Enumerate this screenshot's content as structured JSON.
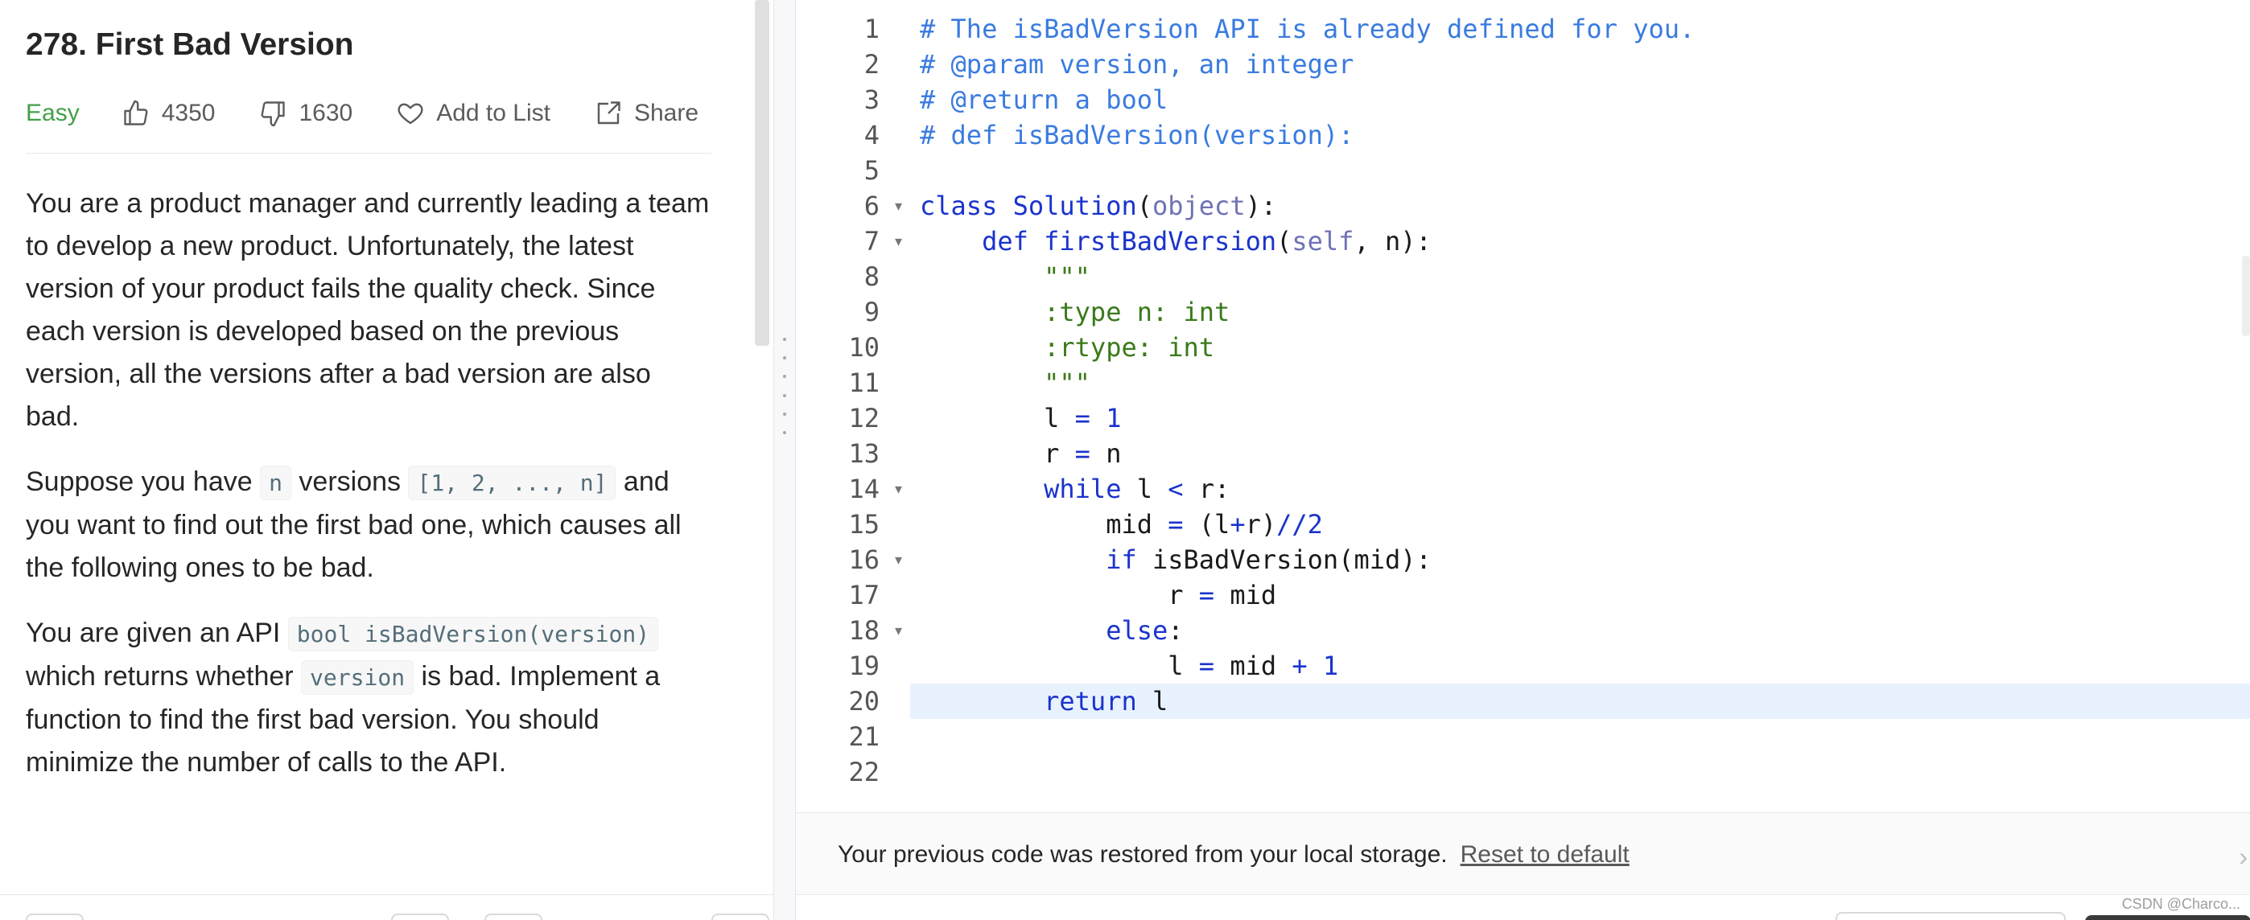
{
  "problem": {
    "title": "278. First Bad Version",
    "difficulty": "Easy",
    "likes": "4350",
    "dislikes": "1630",
    "add_to_list": "Add to List",
    "share": "Share",
    "colors": {
      "difficulty": "#43a047",
      "link_blue": "#1a33cc"
    },
    "icons": [
      "thumbs-up-icon",
      "thumbs-down-icon",
      "heart-icon",
      "share-icon"
    ]
  },
  "description": {
    "p1": "You are a product manager and currently leading a team to develop a new product. Unfortunately, the latest version of your product fails the quality check. Since each version is developed based on the previous version, all the versions after a bad version are also bad.",
    "p2_a": "Suppose you have ",
    "p2_code1": "n",
    "p2_b": " versions ",
    "p2_code2": "[1, 2, ..., n]",
    "p2_c": " and you want to find out the first bad one, which causes all the following ones to be bad.",
    "p3_a": "You are given an API ",
    "p3_code1": "bool isBadVersion(version)",
    "p3_b": " which returns whether ",
    "p3_code2": "version",
    "p3_c": " is bad. Implement a function to find the first bad version. You should minimize the number of calls to the API."
  },
  "editor": {
    "active_line": 20,
    "lines": [
      {
        "n": "1",
        "fold": false,
        "tokens": [
          [
            "comment",
            "# The isBadVersion API is already defined for you."
          ]
        ]
      },
      {
        "n": "2",
        "fold": false,
        "tokens": [
          [
            "comment",
            "# @param version, an integer"
          ]
        ]
      },
      {
        "n": "3",
        "fold": false,
        "tokens": [
          [
            "comment",
            "# @return a bool"
          ]
        ]
      },
      {
        "n": "4",
        "fold": false,
        "tokens": [
          [
            "comment",
            "# def isBadVersion(version):"
          ]
        ]
      },
      {
        "n": "5",
        "fold": false,
        "tokens": []
      },
      {
        "n": "6",
        "fold": true,
        "tokens": [
          [
            "keyword",
            "class"
          ],
          [
            "plain",
            " "
          ],
          [
            "def",
            "Solution"
          ],
          [
            "plain",
            "("
          ],
          [
            "builtin",
            "object"
          ],
          [
            "plain",
            "):"
          ]
        ]
      },
      {
        "n": "7",
        "fold": true,
        "tokens": [
          [
            "plain",
            "    "
          ],
          [
            "keyword",
            "def"
          ],
          [
            "plain",
            " "
          ],
          [
            "def",
            "firstBadVersion"
          ],
          [
            "plain",
            "("
          ],
          [
            "builtin",
            "self"
          ],
          [
            "plain",
            ", n):"
          ]
        ]
      },
      {
        "n": "8",
        "fold": false,
        "tokens": [
          [
            "plain",
            "        "
          ],
          [
            "string",
            "\"\"\""
          ]
        ]
      },
      {
        "n": "9",
        "fold": false,
        "tokens": [
          [
            "plain",
            "        "
          ],
          [
            "string",
            ":type n: int"
          ]
        ]
      },
      {
        "n": "10",
        "fold": false,
        "tokens": [
          [
            "plain",
            "        "
          ],
          [
            "string",
            ":rtype: int"
          ]
        ]
      },
      {
        "n": "11",
        "fold": false,
        "tokens": [
          [
            "plain",
            "        "
          ],
          [
            "string",
            "\"\"\""
          ]
        ]
      },
      {
        "n": "12",
        "fold": false,
        "tokens": [
          [
            "plain",
            "        l "
          ],
          [
            "operator",
            "="
          ],
          [
            "plain",
            " "
          ],
          [
            "number",
            "1"
          ]
        ]
      },
      {
        "n": "13",
        "fold": false,
        "tokens": [
          [
            "plain",
            "        r "
          ],
          [
            "operator",
            "="
          ],
          [
            "plain",
            " n"
          ]
        ]
      },
      {
        "n": "14",
        "fold": true,
        "tokens": [
          [
            "plain",
            "        "
          ],
          [
            "keyword",
            "while"
          ],
          [
            "plain",
            " l "
          ],
          [
            "operator",
            "<"
          ],
          [
            "plain",
            " r:"
          ]
        ]
      },
      {
        "n": "15",
        "fold": false,
        "tokens": [
          [
            "plain",
            "            mid "
          ],
          [
            "operator",
            "="
          ],
          [
            "plain",
            " (l"
          ],
          [
            "operator",
            "+"
          ],
          [
            "plain",
            "r)"
          ],
          [
            "operator",
            "//"
          ],
          [
            "number",
            "2"
          ]
        ]
      },
      {
        "n": "16",
        "fold": true,
        "tokens": [
          [
            "plain",
            "            "
          ],
          [
            "keyword",
            "if"
          ],
          [
            "plain",
            " isBadVersion(mid):"
          ]
        ]
      },
      {
        "n": "17",
        "fold": false,
        "tokens": [
          [
            "plain",
            "                r "
          ],
          [
            "operator",
            "="
          ],
          [
            "plain",
            " mid"
          ]
        ]
      },
      {
        "n": "18",
        "fold": true,
        "tokens": [
          [
            "plain",
            "            "
          ],
          [
            "keyword",
            "else"
          ],
          [
            "plain",
            ":"
          ]
        ]
      },
      {
        "n": "19",
        "fold": false,
        "tokens": [
          [
            "plain",
            "                l "
          ],
          [
            "operator",
            "="
          ],
          [
            "plain",
            " mid "
          ],
          [
            "operator",
            "+"
          ],
          [
            "plain",
            " "
          ],
          [
            "number",
            "1"
          ]
        ]
      },
      {
        "n": "20",
        "fold": false,
        "tokens": [
          [
            "plain",
            "        "
          ],
          [
            "keyword",
            "return"
          ],
          [
            "plain",
            " l"
          ]
        ]
      },
      {
        "n": "21",
        "fold": false,
        "tokens": []
      },
      {
        "n": "22",
        "fold": false,
        "tokens": []
      }
    ]
  },
  "notice": {
    "text": "Your previous code was restored from your local storage.",
    "reset_link": "Reset to default",
    "close_icon": "close-icon"
  },
  "watermark": "CSDN @Charco..."
}
